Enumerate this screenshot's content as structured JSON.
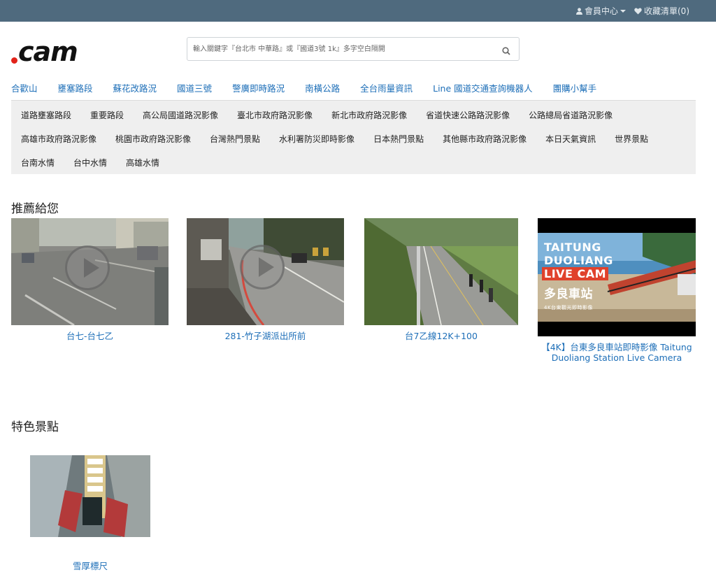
{
  "header": {
    "member_label": "會員中心",
    "wishlist_label": "收藏清單(0)"
  },
  "logo": {
    "text": "cam"
  },
  "search": {
    "placeholder": "輸入關鍵字『台北市 中華路』或『國道3號 1k』多字空白隔開"
  },
  "main_nav": [
    "合歡山",
    "壅塞路段",
    "蘇花改路況",
    "國道三號",
    "警廣即時路況",
    "南橫公路",
    "全台雨量資訊",
    "Line 國道交通查詢機器人",
    "團購小幫手"
  ],
  "sub_nav": {
    "row1": [
      "道路壅塞路段",
      "重要路段",
      "高公局國道路況影像",
      "臺北市政府路況影像",
      "新北市政府路況影像",
      "省道快速公路路況影像",
      "公路總局省道路況影像"
    ],
    "row2": [
      "高雄市政府路況影像",
      "桃園市政府路況影像",
      "台灣熱門景點",
      "水利署防災即時影像",
      "日本熱門景點",
      "其他縣市政府路況影像",
      "本日天氣資訊",
      "世界景點"
    ],
    "row3": [
      "台南水情",
      "台中水情",
      "高雄水情"
    ]
  },
  "recommended": {
    "title": "推薦給您",
    "items": [
      {
        "caption": "台七-台七乙"
      },
      {
        "caption": "281-竹子湖派出所前"
      },
      {
        "caption": "台7乙線12K+100"
      },
      {
        "caption": "【4K】台東多良車站即時影像 Taitung Duoliang Station Live Camera",
        "overlay": {
          "line1": "TAITUNG",
          "line2": "DUOLIANG",
          "line3": "LIVE CAM",
          "station": "多良車站",
          "sub": "4K台東觀光即時影像"
        }
      }
    ]
  },
  "featured": {
    "title": "特色景點",
    "items": [
      {
        "caption": "雪厚標尺"
      }
    ]
  },
  "colors": {
    "topbar": "#4f6a7e",
    "link": "#1e6fb8",
    "logo_dot": "#e2231a"
  }
}
